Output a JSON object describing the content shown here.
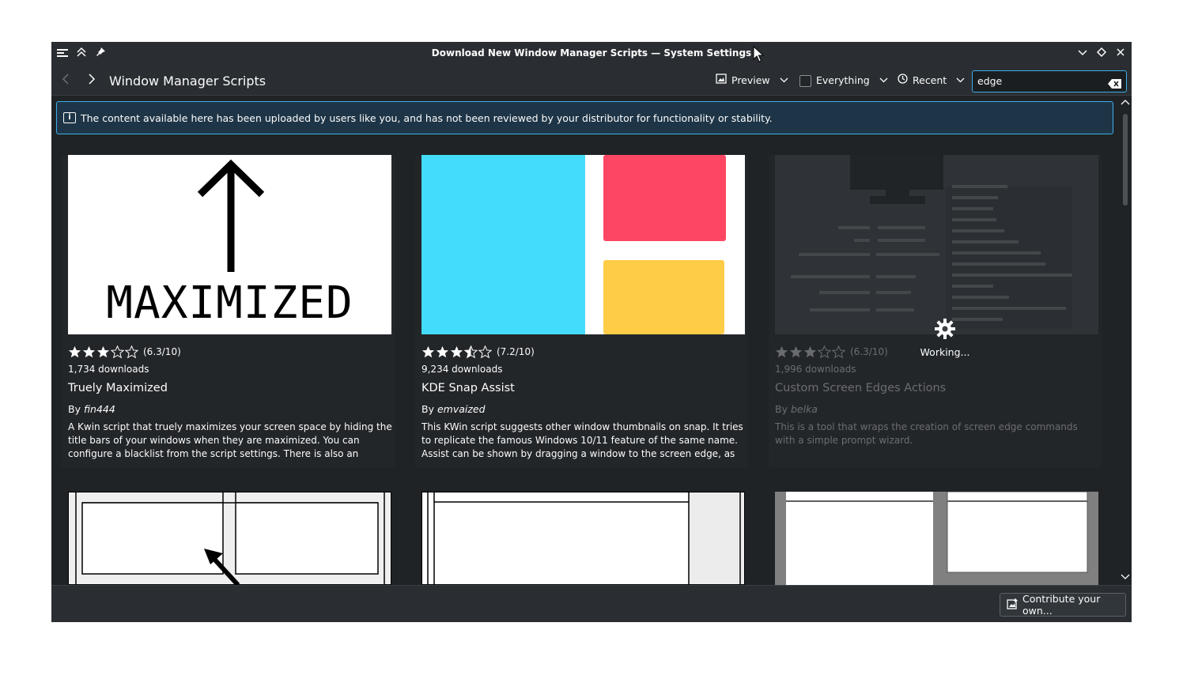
{
  "window": {
    "title": "Download New Window Manager Scripts — System Settings"
  },
  "toolbar": {
    "page_title": "Window Manager Scripts",
    "view_mode": "Preview",
    "category": "Everything",
    "sort": "Recent",
    "search_value": "edge"
  },
  "banner": {
    "text": "The content available here has been uploaded by users like you, and has not been reviewed by your distributor for functionality or stability."
  },
  "cards": [
    {
      "rating": 6.3,
      "rating_text": "(6.3/10)",
      "downloads": "1,734 downloads",
      "name": "Truely Maximized",
      "by": "By",
      "author": "fin444",
      "description": "A Kwin script that truely maximizes your screen space by hiding the title bars of your windows when they are maximized. You can configure a blacklist from the script settings. There is also an optional screen edge ...",
      "thumb_text": "MAXIMIZED"
    },
    {
      "rating": 7.2,
      "rating_text": "(7.2/10)",
      "downloads": "9,234 downloads",
      "name": "KDE Snap Assist",
      "by": "By",
      "author": "emvaized",
      "description": "This KWin script suggests other window thumbnails on snap. It tries to replicate the famous Windows 10/11 feature of the same name. Assist can be shown by dragging a window to the screen edge, as well ..."
    },
    {
      "rating": 6.3,
      "rating_text": "(6.3/10)",
      "downloads": "1,996 downloads",
      "name": "Custom Screen Edges Actions",
      "by": "By",
      "author": "belka",
      "description": "This is a tool that wraps the creation of screen edge commands with a simple prompt wizard.",
      "status": "Working..."
    }
  ],
  "footer": {
    "contribute_label": "Contribute your own..."
  },
  "colors": {
    "accent": "#3daee9",
    "window_bg": "#202326",
    "banner_bg": "#1e3547",
    "snap_blue": "#44dcfd",
    "snap_red": "#fd4663",
    "snap_yellow": "#fecc46"
  }
}
